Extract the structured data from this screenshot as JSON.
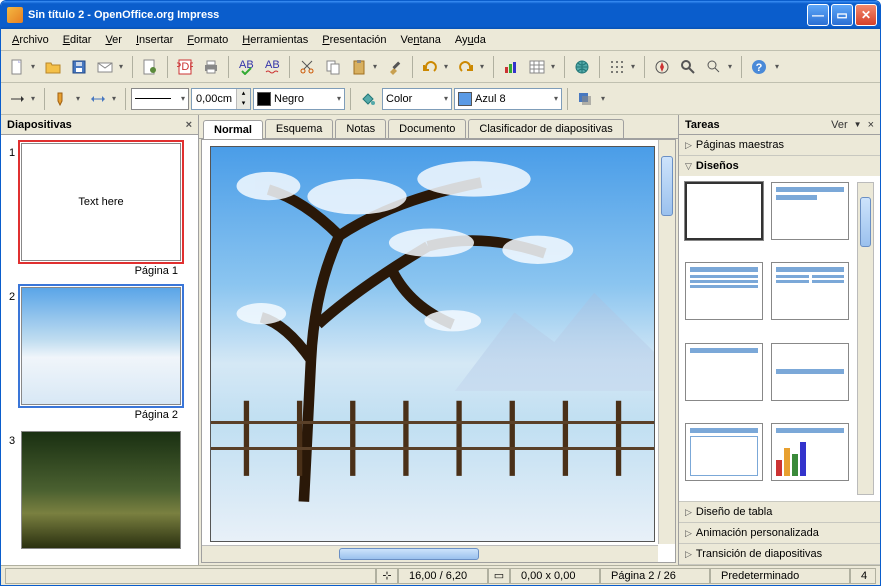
{
  "window": {
    "title": "Sin título 2 - OpenOffice.org Impress"
  },
  "menu": {
    "archivo": "Archivo",
    "editar": "Editar",
    "ver": "Ver",
    "insertar": "Insertar",
    "formato": "Formato",
    "herramientas": "Herramientas",
    "presentacion": "Presentación",
    "ventana": "Ventana",
    "ayuda": "Ayuda"
  },
  "toolbar2": {
    "width": "0,00cm",
    "color_label": "Negro",
    "fill_mode": "Color",
    "fill_color": "Azul 8"
  },
  "slides_panel": {
    "title": "Diapositivas",
    "items": [
      {
        "num": "1",
        "text": "Text here",
        "caption": "Página 1",
        "kind": "text",
        "selected": "red"
      },
      {
        "num": "2",
        "text": "",
        "caption": "Página 2",
        "kind": "winter",
        "selected": "blue"
      },
      {
        "num": "3",
        "text": "",
        "caption": "",
        "kind": "forest",
        "selected": ""
      }
    ]
  },
  "view_tabs": {
    "normal": "Normal",
    "esquema": "Esquema",
    "notas": "Notas",
    "documento": "Documento",
    "clasificador": "Clasificador de diapositivas"
  },
  "tasks_panel": {
    "title": "Tareas",
    "ver": "Ver",
    "sections": {
      "maestras": "Páginas maestras",
      "disenos": "Diseños",
      "tabla": "Diseño de tabla",
      "anim": "Animación personalizada",
      "trans": "Transición de diapositivas"
    }
  },
  "status": {
    "pos": "16,00 / 6,20",
    "size": "0,00 x 0,00",
    "page": "Página 2 / 26",
    "mode": "Predeterminado",
    "zoom": "4"
  }
}
